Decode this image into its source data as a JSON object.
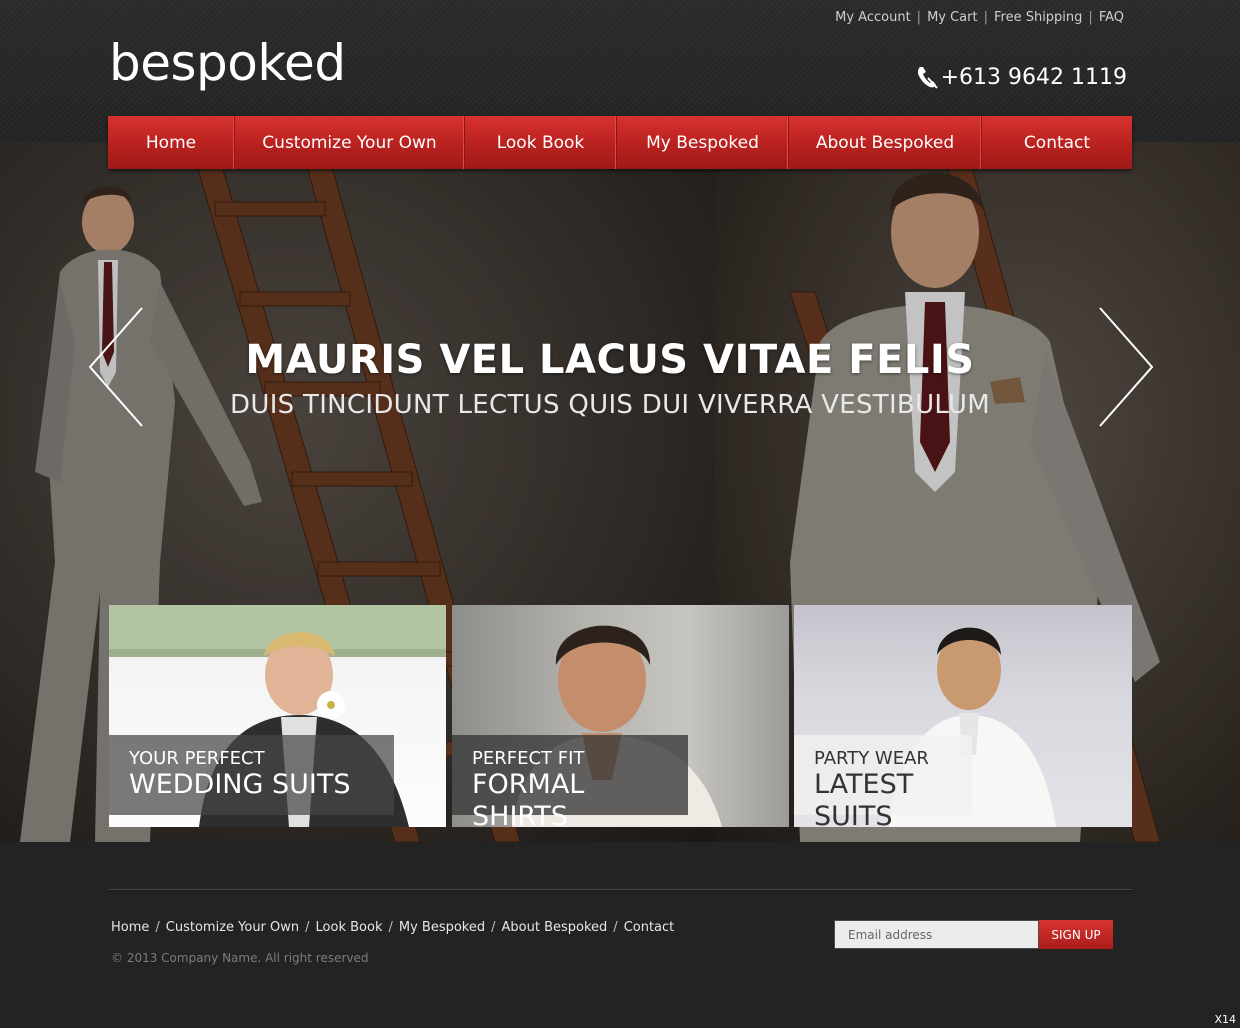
{
  "top_links": [
    "My Account",
    "My Cart",
    "Free Shipping",
    "FAQ"
  ],
  "brand": "bespoked",
  "phone": {
    "number": "+613 9642 1119",
    "icon": "phone-icon"
  },
  "nav": [
    "Home",
    "Customize Your Own",
    "Look Book",
    "My Bespoked",
    "About Bespoked",
    "Contact"
  ],
  "slider": {
    "title": "MAURIS VEL LACUS VITAE FELIS",
    "subtitle": "DUIS TINCIDUNT LECTUS QUIS DUI VIVERRA VESTIBULUM",
    "prev_icon": "chevron-left-icon",
    "next_icon": "chevron-right-icon"
  },
  "tiles": [
    {
      "kicker": "YOUR PERFECT",
      "heading": "WEDDING SUITS"
    },
    {
      "kicker": "PERFECT FIT",
      "heading": "FORMAL SHIRTS"
    },
    {
      "kicker": "PARTY WEAR",
      "heading": "LATEST SUITS"
    }
  ],
  "footer": {
    "links": [
      "Home",
      "Customize Your Own",
      "Look Book",
      "My Bespoked",
      "About Bespoked",
      "Contact"
    ],
    "copyright": "© 2013 Company Name.  All right reserved",
    "email_placeholder": "Email address",
    "signup_label": "SIGN UP"
  },
  "corner_badge": "X14",
  "colors": {
    "accent_red": "#c0241f",
    "header_bg": "#2a2a2a",
    "footer_bg": "#232323"
  }
}
